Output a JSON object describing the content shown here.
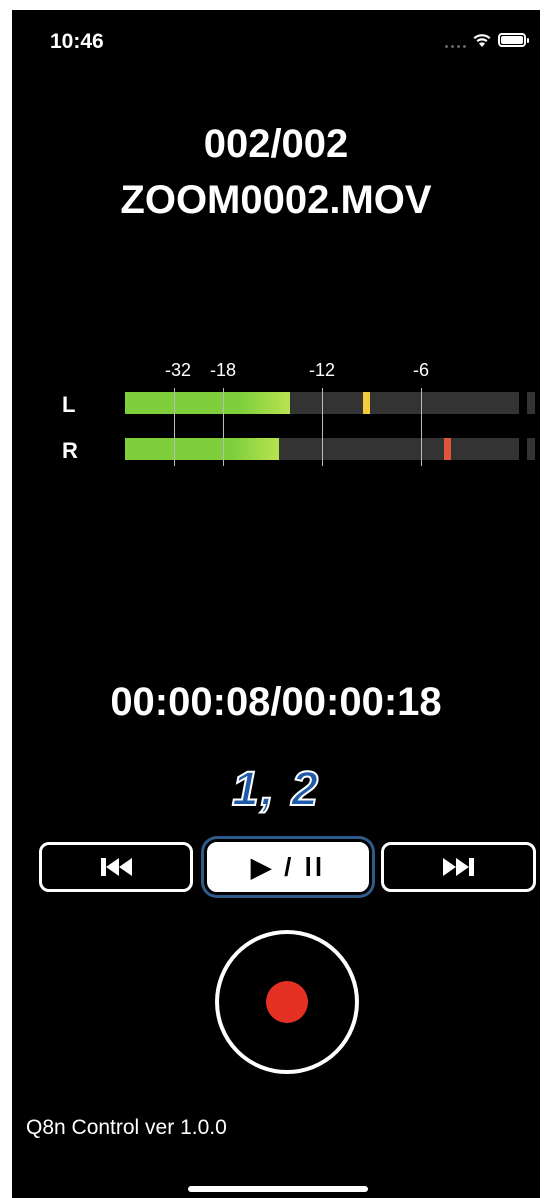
{
  "status_bar": {
    "time": "10:46",
    "icons": [
      "cellular-signal-icon",
      "wifi-icon",
      "battery-icon"
    ]
  },
  "playback": {
    "file_counter": "002/002",
    "file_name": "ZOOM0002.MOV",
    "time_display": "00:00:08/00:00:18"
  },
  "level_meter": {
    "scale_labels": [
      "-32",
      "-18",
      "-12",
      "-6"
    ],
    "channels": [
      {
        "label": "L",
        "level_fraction": 0.42,
        "peak_fraction": 0.605,
        "peak_color": "#f2cc3c"
      },
      {
        "label": "R",
        "level_fraction": 0.39,
        "peak_fraction": 0.81,
        "peak_color": "#e0563a"
      }
    ]
  },
  "annotation": {
    "callout": "1, 2"
  },
  "controls": {
    "prev_icon": "skip-previous-icon",
    "play_pause_label": "▶ / ll",
    "next_icon": "skip-next-icon",
    "record_icon": "record-icon"
  },
  "footer": {
    "app_version": "Q8n Control ver 1.0.0"
  },
  "colors": {
    "meter_green": "#7fcf3c",
    "record_red": "#e53024",
    "callout_blue": "#1e5aa8"
  }
}
